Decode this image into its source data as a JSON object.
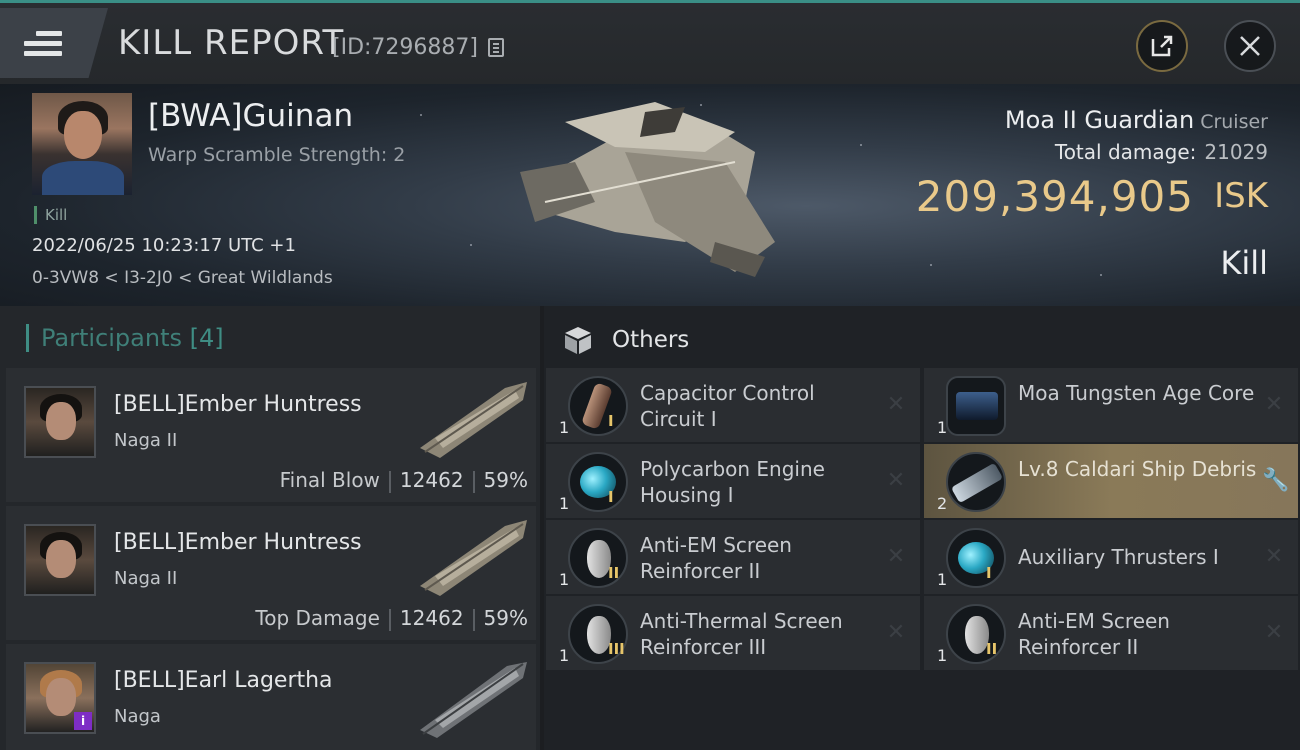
{
  "header": {
    "title": "KILL REPORT",
    "report_id": "[ID:7296887]"
  },
  "victim": {
    "name": "[BWA]Guinan",
    "subtitle": "Warp Scramble Strength: 2",
    "tag": "Kill",
    "time": "2022/06/25 10:23:17 UTC +1",
    "location": "0-3VW8 < I3-2J0 < Great Wildlands",
    "ship_name": "Moa II Guardian",
    "ship_class": "Cruiser",
    "total_damage_label": "Total damage:",
    "total_damage": "21029",
    "isk_value": "209,394,905",
    "isk_label": "ISK",
    "result": "Kill"
  },
  "participants": {
    "label": "Participants",
    "count": "[4]",
    "rows": [
      {
        "name": "[BELL]Ember Huntress",
        "ship": "Naga II",
        "role": "Final Blow",
        "damage": "12462",
        "percent": "59%"
      },
      {
        "name": "[BELL]Ember Huntress",
        "ship": "Naga II",
        "role": "Top Damage",
        "damage": "12462",
        "percent": "59%"
      },
      {
        "name": "[BELL]Earl Lagertha",
        "ship": "Naga",
        "badge": "i"
      }
    ]
  },
  "others": {
    "label": "Others",
    "items": [
      {
        "name": "Capacitor Control Circuit I",
        "qty": "1",
        "tier": "I",
        "icon": "capacitor-icon",
        "action": "✕"
      },
      {
        "name": "Moa Tungsten Age Core",
        "qty": "1",
        "tier": "",
        "icon": "core-icon",
        "action": "✕"
      },
      {
        "name": "Polycarbon Engine Housing I",
        "qty": "1",
        "tier": "I",
        "icon": "engine-icon",
        "action": "✕"
      },
      {
        "name": "Lv.8 Caldari Ship Debris",
        "qty": "2",
        "tier": "",
        "icon": "debris-icon",
        "action": "🔧"
      },
      {
        "name": "Anti-EM Screen Reinforcer II",
        "qty": "1",
        "tier": "II",
        "icon": "shield-icon",
        "action": "✕"
      },
      {
        "name": "Auxiliary Thrusters I",
        "qty": "1",
        "tier": "I",
        "icon": "thruster-icon",
        "action": "✕"
      },
      {
        "name": "Anti-Thermal Screen Reinforcer III",
        "qty": "1",
        "tier": "III",
        "icon": "shield-icon",
        "action": "✕"
      },
      {
        "name": "Anti-EM Screen Reinforcer II",
        "qty": "1",
        "tier": "II",
        "icon": "shield-icon",
        "action": "✕"
      }
    ]
  },
  "colors": {
    "accent": "#3f8d84",
    "isk": "#e9c98a",
    "highlight": "#8a7a58"
  }
}
